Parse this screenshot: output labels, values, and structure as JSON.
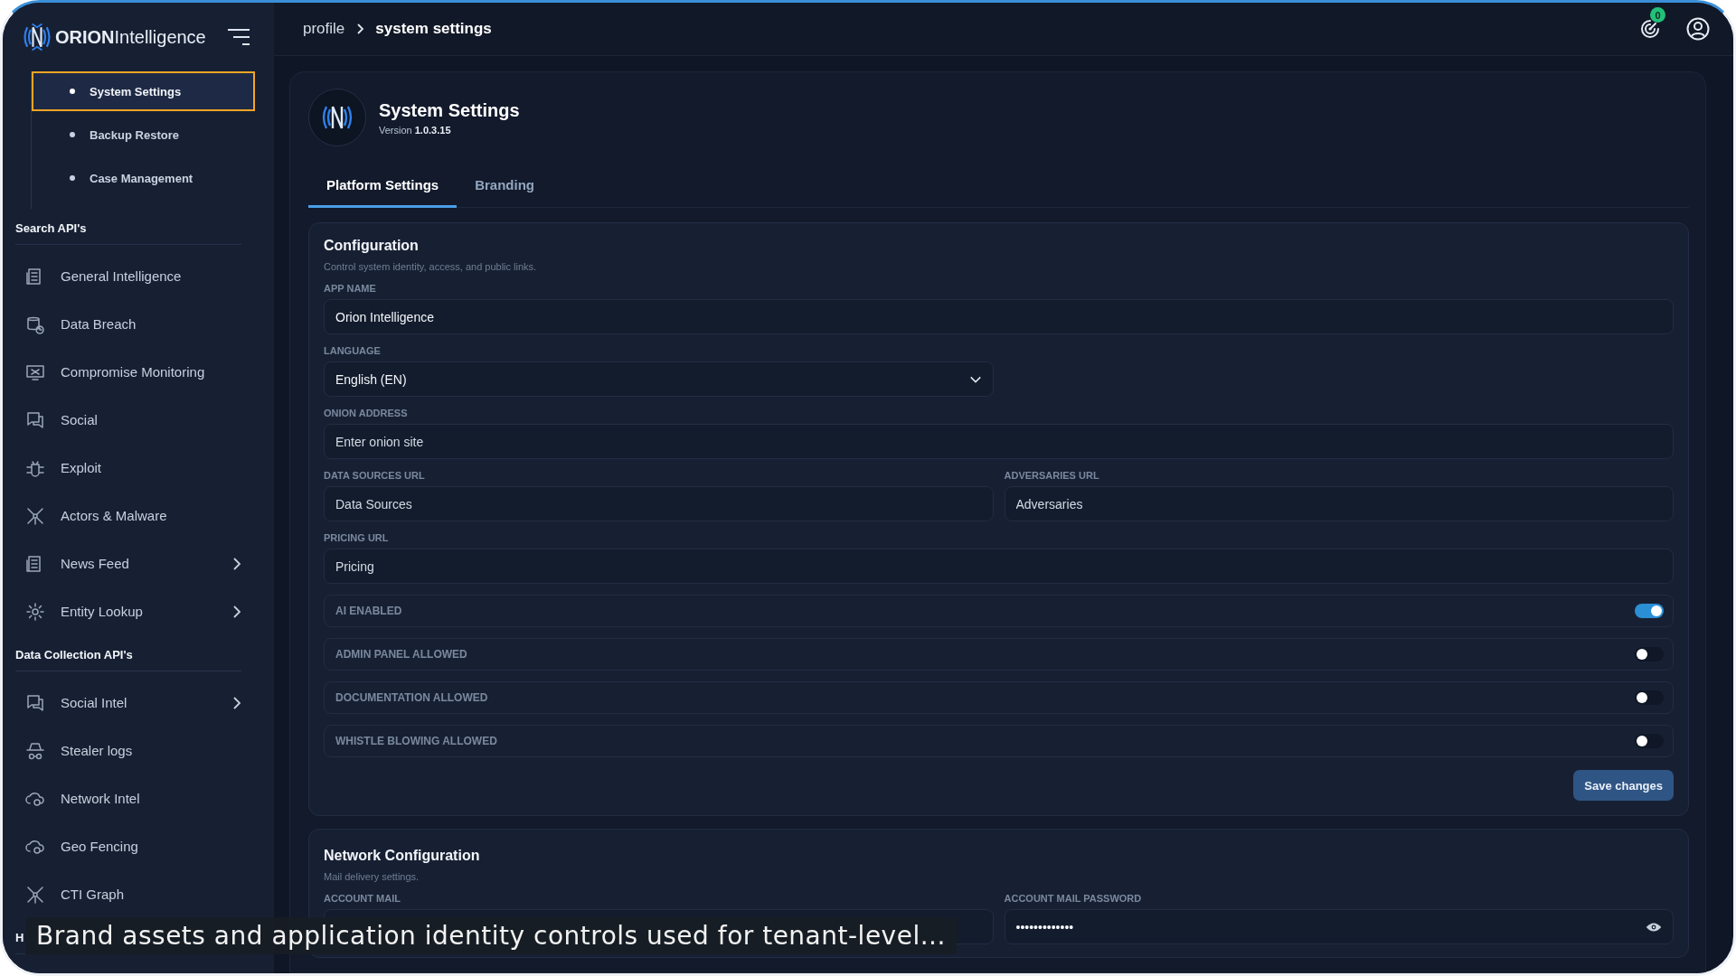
{
  "brand": {
    "name_bold": "ORION",
    "name_rest": "Intelligence"
  },
  "breadcrumb": [
    "profile",
    "system settings"
  ],
  "notifications": {
    "count": "0"
  },
  "sidebar": {
    "sub_items": [
      {
        "label": "System Settings",
        "selected": true
      },
      {
        "label": "Backup Restore",
        "selected": false
      },
      {
        "label": "Case Management",
        "selected": false
      }
    ],
    "sections": [
      {
        "title": "Search API's",
        "items": [
          {
            "label": "General Intelligence",
            "expandable": false
          },
          {
            "label": "Data Breach",
            "expandable": false
          },
          {
            "label": "Compromise Monitoring",
            "expandable": false
          },
          {
            "label": "Social",
            "expandable": false
          },
          {
            "label": "Exploit",
            "expandable": false
          },
          {
            "label": "Actors & Malware",
            "expandable": false
          },
          {
            "label": "News Feed",
            "expandable": true
          },
          {
            "label": "Entity Lookup",
            "expandable": true
          }
        ]
      },
      {
        "title": "Data Collection API's",
        "items": [
          {
            "label": "Social Intel",
            "expandable": true
          },
          {
            "label": "Stealer logs",
            "expandable": false
          },
          {
            "label": "Network Intel",
            "expandable": false
          },
          {
            "label": "Geo Fencing",
            "expandable": false
          },
          {
            "label": "CTI Graph",
            "expandable": false
          }
        ]
      },
      {
        "title": "H"
      }
    ]
  },
  "page": {
    "title": "System Settings",
    "version_label": "Version",
    "version": "1.0.3.15"
  },
  "tabs": [
    {
      "label": "Platform Settings",
      "selected": true
    },
    {
      "label": "Branding",
      "selected": false
    }
  ],
  "configuration": {
    "title": "Configuration",
    "description": "Control system identity, access, and public links.",
    "rows": [
      [
        {
          "kind": "text",
          "label": "APP NAME",
          "value": "Orion Intelligence",
          "wide": true
        }
      ],
      [
        {
          "kind": "select",
          "label": "LANGUAGE",
          "value": "English (EN)",
          "wide": false
        }
      ],
      [
        {
          "kind": "text",
          "label": "ONION ADDRESS",
          "placeholder": "Enter onion site",
          "wide": true
        }
      ],
      [
        {
          "kind": "text",
          "label": "DATA SOURCES URL",
          "placeholder": "Data Sources",
          "wide": false
        },
        {
          "kind": "text",
          "label": "ADVERSARIES URL",
          "placeholder": "Adversaries",
          "wide": false
        }
      ],
      [
        {
          "kind": "text",
          "label": "PRICING URL",
          "placeholder": "Pricing",
          "wide": true
        }
      ]
    ],
    "toggles": [
      {
        "label": "AI ENABLED",
        "on": true
      },
      {
        "label": "ADMIN PANEL ALLOWED",
        "on": false
      },
      {
        "label": "DOCUMENTATION ALLOWED",
        "on": false
      },
      {
        "label": "WHISTLE BLOWING ALLOWED",
        "on": false
      }
    ],
    "save_button": "Save changes"
  },
  "network": {
    "title": "Network Configuration",
    "description": "Mail delivery settings.",
    "fields": [
      {
        "kind": "text",
        "label": "ACCOUNT MAIL"
      },
      {
        "kind": "password",
        "label": "ACCOUNT MAIL PASSWORD",
        "value": "•••••••••••••"
      }
    ]
  },
  "caption": "Brand assets and application identity controls used for tenant-level..."
}
